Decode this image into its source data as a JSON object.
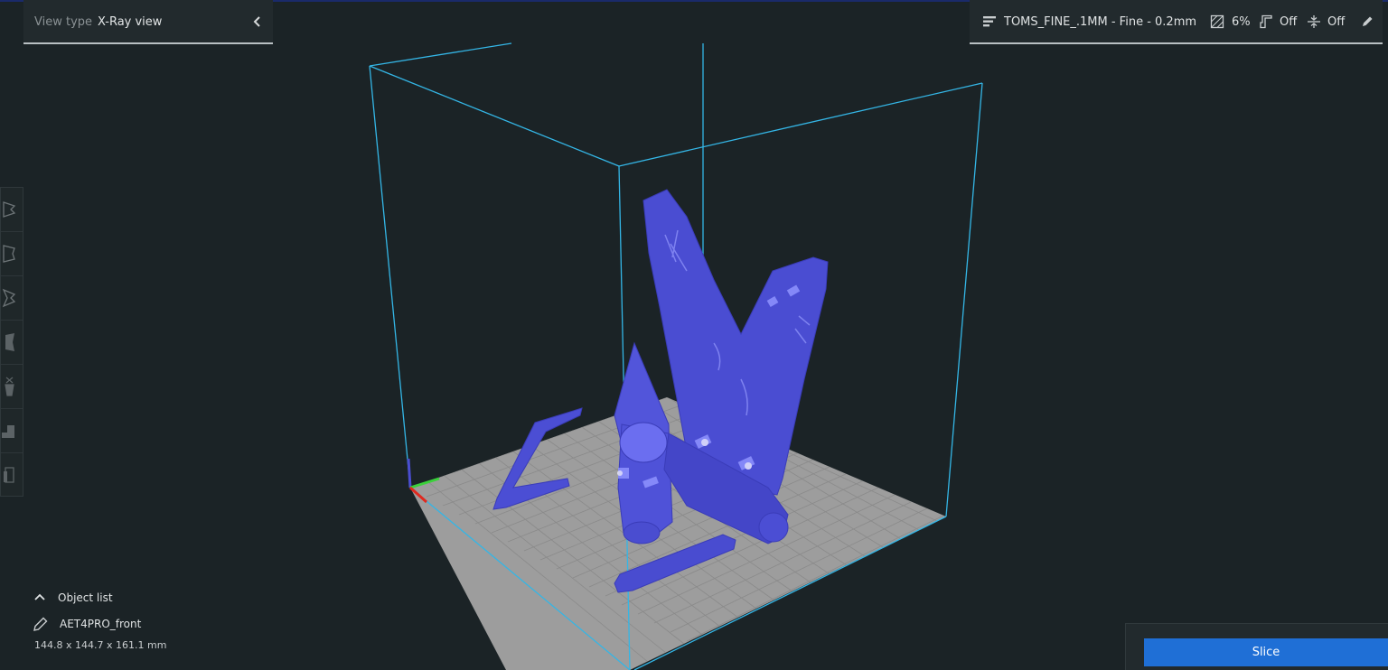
{
  "view_type": {
    "label": "View type",
    "value": "X-Ray view",
    "collapse_icon": "chevron-left-icon"
  },
  "print_settings": {
    "profile": "TOMS_FINE_.1MM - Fine - 0.2mm",
    "infill": "6%",
    "support": "Off",
    "adhesion": "Off",
    "icons": [
      "profile-layers-icon",
      "infill-icon",
      "support-icon",
      "adhesion-icon",
      "edit-pencil-icon"
    ]
  },
  "toolbar": {
    "tools": [
      {
        "name": "move-tool",
        "icon": "move-icon"
      },
      {
        "name": "scale-tool",
        "icon": "scale-icon"
      },
      {
        "name": "rotate-tool",
        "icon": "rotate-icon"
      },
      {
        "name": "mirror-tool",
        "icon": "mirror-icon"
      },
      {
        "name": "per-model-settings-tool",
        "icon": "per-model-settings-icon"
      },
      {
        "name": "support-blocker-tool",
        "icon": "support-blocker-icon"
      },
      {
        "name": "extra-tool",
        "icon": "extra-tool-icon"
      }
    ]
  },
  "object_list": {
    "label": "Object list",
    "object_name": "AET4PRO_front",
    "dimensions": "144.8 x 144.7 x 161.1 mm"
  },
  "slice": {
    "label": "Slice"
  },
  "colors": {
    "background": "#1b2326",
    "panel": "#222a2d",
    "build_volume_outline": "#34b6e6",
    "model_xray": "#4a4dd0",
    "build_plate": "#9c9c9c",
    "slice_button": "#1f6fd6"
  }
}
